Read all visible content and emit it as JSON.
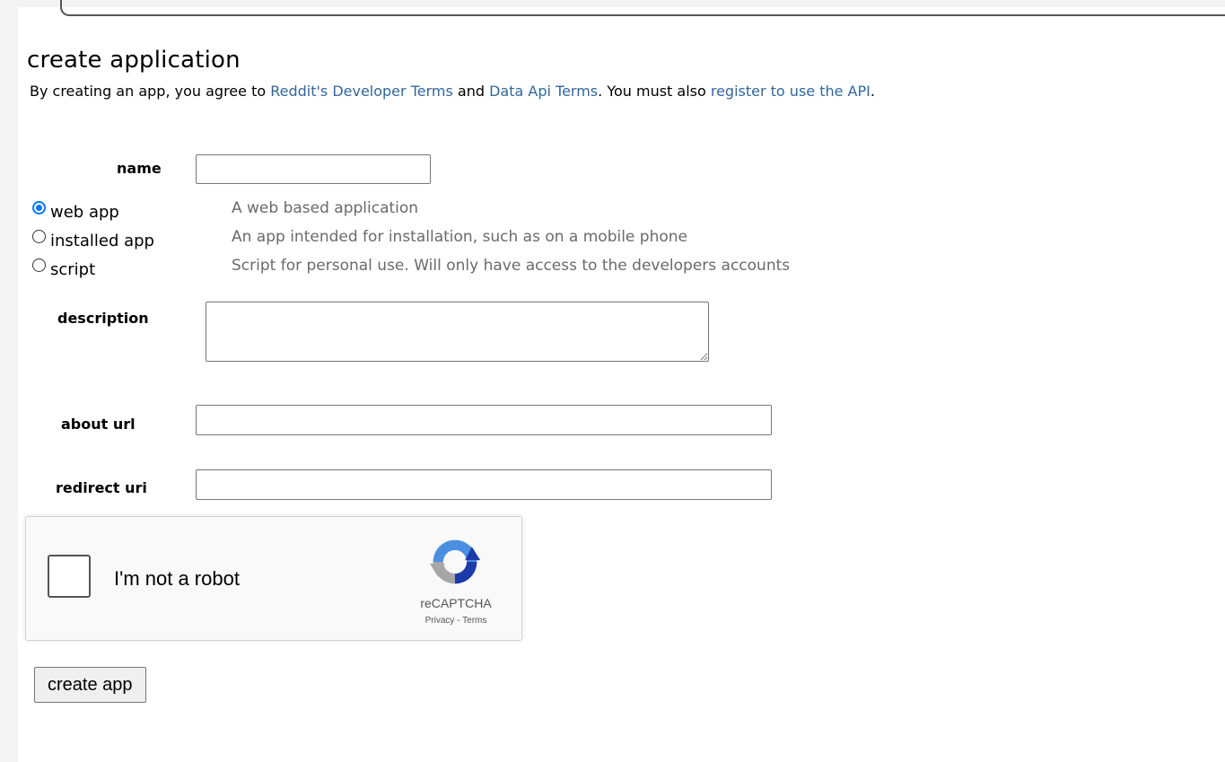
{
  "page": {
    "title": "create application"
  },
  "terms": {
    "prefix": "By creating an app, you agree to ",
    "developer_terms_link": "Reddit's Developer Terms",
    "and": " and ",
    "data_api_terms_link": "Data Api Terms",
    "middle": ". You must also ",
    "register_link": "register to use the API",
    "suffix": "."
  },
  "form": {
    "name_label": "name",
    "name_value": "",
    "app_types": [
      {
        "label": "web app",
        "description": "A web based application",
        "checked": true
      },
      {
        "label": "installed app",
        "description": "An app intended for installation, such as on a mobile phone",
        "checked": false
      },
      {
        "label": "script",
        "description": "Script for personal use. Will only have access to the developers accounts",
        "checked": false
      }
    ],
    "description_label": "description",
    "description_value": "",
    "about_url_label": "about url",
    "about_url_value": "",
    "redirect_uri_label": "redirect uri",
    "redirect_uri_value": ""
  },
  "captcha": {
    "checkbox_text": "I'm not a robot",
    "brand": "reCAPTCHA",
    "links": "Privacy - Terms",
    "logo_icon": "recaptcha-logo-icon"
  },
  "actions": {
    "create_label": "create app"
  },
  "colors": {
    "link": "#336699",
    "description_text": "#6a6a6a",
    "radio_accent": "#0075ff"
  }
}
